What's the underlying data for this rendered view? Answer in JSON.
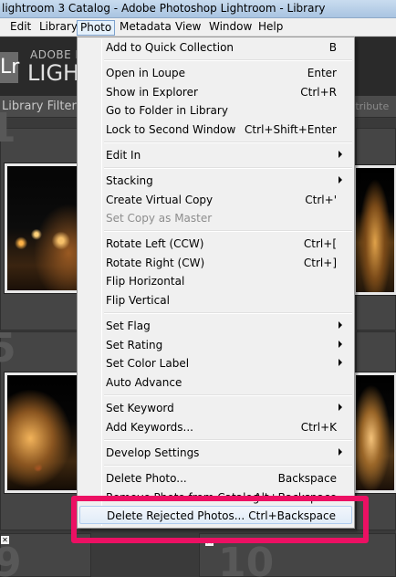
{
  "window": {
    "title": "lightroom 3 Catalog - Adobe Photoshop Lightroom - Library"
  },
  "menubar": {
    "items": [
      "Edit",
      "Library",
      "Photo",
      "Metadata",
      "View",
      "Window",
      "Help"
    ],
    "active": "Photo"
  },
  "header": {
    "logo_glyph": "Lr",
    "brand_line1": "ADOBE P",
    "brand_line2": "LIGHT"
  },
  "filterbar": {
    "label": "Library Filter :",
    "right_label": "ttribute"
  },
  "grid": {
    "cell_numbers": [
      "1",
      "5",
      "9",
      "10"
    ]
  },
  "menu": {
    "items": [
      {
        "label": "Add to Quick Collection",
        "shortcut": "B"
      },
      {
        "label": "Open in Loupe",
        "shortcut": "Enter"
      },
      {
        "label": "Show in Explorer",
        "shortcut": "Ctrl+R"
      },
      {
        "label": "Go to Folder in Library",
        "shortcut": ""
      },
      {
        "label": "Lock to Second Window",
        "shortcut": "Ctrl+Shift+Enter"
      },
      {
        "label": "Edit In",
        "shortcut": "",
        "submenu": true
      },
      {
        "label": "Stacking",
        "shortcut": "",
        "submenu": true
      },
      {
        "label": "Create Virtual Copy",
        "shortcut": "Ctrl+'"
      },
      {
        "label": "Set Copy as Master",
        "shortcut": "",
        "disabled": true
      },
      {
        "label": "Rotate Left (CCW)",
        "shortcut": "Ctrl+["
      },
      {
        "label": "Rotate Right (CW)",
        "shortcut": "Ctrl+]"
      },
      {
        "label": "Flip Horizontal",
        "shortcut": ""
      },
      {
        "label": "Flip Vertical",
        "shortcut": ""
      },
      {
        "label": "Set Flag",
        "shortcut": "",
        "submenu": true
      },
      {
        "label": "Set Rating",
        "shortcut": "",
        "submenu": true
      },
      {
        "label": "Set Color Label",
        "shortcut": "",
        "submenu": true
      },
      {
        "label": "Auto Advance",
        "shortcut": ""
      },
      {
        "label": "Set Keyword",
        "shortcut": "",
        "submenu": true
      },
      {
        "label": "Add Keywords...",
        "shortcut": "Ctrl+K"
      },
      {
        "label": "Develop Settings",
        "shortcut": "",
        "submenu": true
      },
      {
        "label": "Delete Photo...",
        "shortcut": "Backspace"
      },
      {
        "label": "Remove Photo from Catalog",
        "shortcut": "Alt+Backspace"
      },
      {
        "label": "Delete Rejected Photos...",
        "shortcut": "Ctrl+Backspace",
        "highlighted": true
      }
    ]
  },
  "colors": {
    "annotation": "#ec1063",
    "menu_bg": "#f0f0f0",
    "highlight": "#e1ecf8"
  }
}
